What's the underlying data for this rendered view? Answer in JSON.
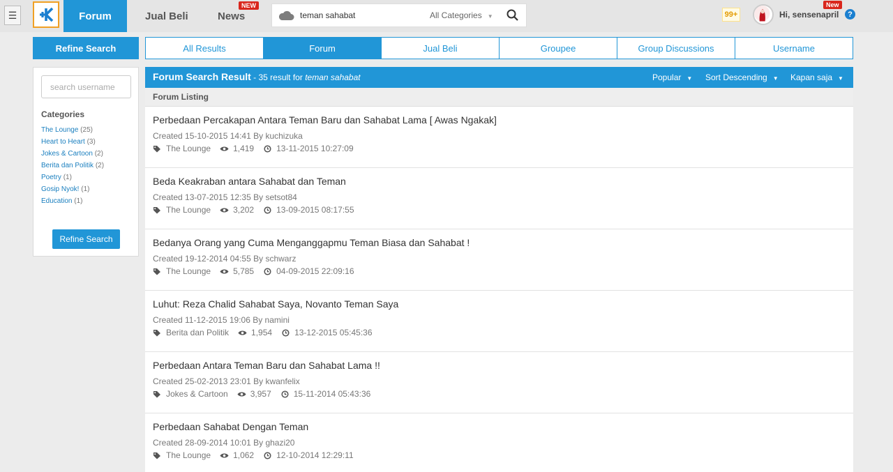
{
  "topbar": {
    "nav": {
      "forum": "Forum",
      "jual_beli": "Jual Beli",
      "news": "News",
      "news_badge": "NEW"
    },
    "search": {
      "value": "teman sahabat",
      "category": "All Categories"
    },
    "notifications": "99+",
    "user": {
      "greeting": "Hi, sensenapril",
      "badge": "New"
    },
    "help": "?"
  },
  "sidebar": {
    "header": "Refine Search",
    "search_placeholder": "search username",
    "categories_title": "Categories",
    "categories": [
      {
        "name": "The Lounge",
        "count": "(25)"
      },
      {
        "name": "Heart to Heart",
        "count": "(3)"
      },
      {
        "name": "Jokes & Cartoon",
        "count": "(2)"
      },
      {
        "name": "Berita dan Politik",
        "count": "(2)"
      },
      {
        "name": "Poetry",
        "count": "(1)"
      },
      {
        "name": "Gosip Nyok!",
        "count": "(1)"
      },
      {
        "name": "Education",
        "count": "(1)"
      }
    ],
    "button": "Refine Search"
  },
  "tabs": [
    "All Results",
    "Forum",
    "Jual Beli",
    "Groupee",
    "Group Discussions",
    "Username"
  ],
  "active_tab": "Forum",
  "result_header": {
    "title": "Forum Search Result",
    "count_text": " - 35 result for ",
    "term": "teman sahabat",
    "sort_popular": "Popular",
    "sort_order": "Sort Descending",
    "time": "Kapan saja"
  },
  "listing_label": "Forum Listing",
  "threads": [
    {
      "title": "Perbedaan Percakapan Antara Teman Baru dan Sahabat Lama [ Awas Ngakak]",
      "created": "Created 15-10-2015 14:41 By kuchizuka",
      "category": "The Lounge",
      "views": "1,419",
      "last": "13-11-2015 10:27:09"
    },
    {
      "title": "Beda Keakraban antara Sahabat dan Teman",
      "created": "Created 13-07-2015 12:35 By setsot84",
      "category": "The Lounge",
      "views": "3,202",
      "last": "13-09-2015 08:17:55"
    },
    {
      "title": "Bedanya Orang yang Cuma Menganggapmu Teman Biasa dan Sahabat !",
      "created": "Created 19-12-2014 04:55 By schwarz",
      "category": "The Lounge",
      "views": "5,785",
      "last": "04-09-2015 22:09:16"
    },
    {
      "title": "Luhut: Reza Chalid Sahabat Saya, Novanto Teman Saya",
      "created": "Created 11-12-2015 19:06 By namini",
      "category": "Berita dan Politik",
      "views": "1,954",
      "last": "13-12-2015 05:45:36"
    },
    {
      "title": "Perbedaan Antara Teman Baru dan Sahabat Lama !!",
      "created": "Created 25-02-2013 23:01 By kwanfelix",
      "category": "Jokes & Cartoon",
      "views": "3,957",
      "last": "15-11-2014 05:43:36"
    },
    {
      "title": "Perbedaan Sahabat Dengan Teman",
      "created": "Created 28-09-2014 10:01 By ghazi20",
      "category": "The Lounge",
      "views": "1,062",
      "last": "12-10-2014 12:29:11"
    }
  ],
  "colors": {
    "accent": "#2196d7",
    "logo_border": "#f0a024",
    "badge": "#d9261c"
  }
}
